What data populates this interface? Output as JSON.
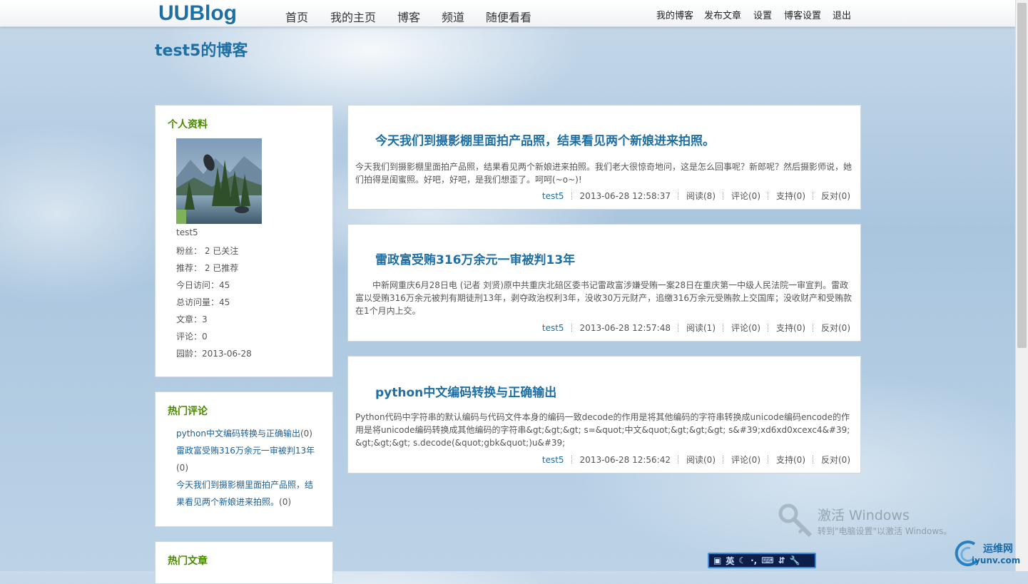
{
  "header": {
    "logo": "UUBlog",
    "main_nav": [
      "首页",
      "我的主页",
      "博客",
      "频道",
      "随便看看"
    ],
    "user_nav": [
      "我的博客",
      "发布文章",
      "设置",
      "博客设置",
      "退出"
    ]
  },
  "blog_title": "test5的博客",
  "profile": {
    "heading": "个人资料",
    "username": "test5",
    "stats": [
      "粉丝： 2 已关注",
      "推荐： 2 已推荐",
      "今日访问：45",
      "总访问量：45",
      "文章：3",
      "评论：0",
      "园龄：2013-06-28"
    ]
  },
  "hot_comments": {
    "heading": "热门评论",
    "items": [
      {
        "title": "python中文编码转换与正确输出",
        "count": "(0)"
      },
      {
        "title": "雷政富受贿316万余元一审被判13年",
        "count": "(0)"
      },
      {
        "title": "今天我们到摄影棚里面拍产品照，结果看见两个新娘进来拍照。",
        "count": "(0)"
      }
    ]
  },
  "hot_articles": {
    "heading": "热门文章"
  },
  "posts": [
    {
      "title": "今天我们到摄影棚里面拍产品照，结果看见两个新娘进来拍照。",
      "body": "今天我们到摄影棚里面拍产品照，结果看见两个新娘进来拍照。我们老大很惊奇地问，这是怎么回事呢？新郎呢？然后摄影师说，她们拍得是闺蜜照。好吧，好吧，是我们想歪了。呵呵(~o~)!",
      "author": "test5",
      "time": "2013-06-28 12:58:37",
      "reads": "阅读(8)",
      "comments": "评论(0)",
      "support": "支持(0)",
      "oppose": "反对(0)"
    },
    {
      "title": "雷政富受贿316万余元一审被判13年",
      "body": "　　中新网重庆6月28日电 (记者 刘贤)原中共重庆北碚区委书记雷政富涉嫌受贿一案28日在重庆第一中级人民法院一审宣判。雷政富以受贿316万余元被判有期徒刑13年，剥夺政治权利3年，没收30万元财产，追缴316万余元受贿款上交国库；没收财产和受贿款在1个月内上交。",
      "author": "test5",
      "time": "2013-06-28 12:57:48",
      "reads": "阅读(1)",
      "comments": "评论(0)",
      "support": "支持(0)",
      "oppose": "反对(0)"
    },
    {
      "title": "python中文编码转换与正确输出",
      "body": "Python代码中字符串的默认编码与代码文件本身的编码一致decode的作用是将其他编码的字符串转换成unicode编码encode的作用是将unicode编码转换成其他编码的字符串&gt;&gt;&gt; s=&quot;中文&quot;&gt;&gt;&gt; s&#39;xd6xd0xcexc4&#39;&gt;&gt;&gt; s.decode(&quot;gbk&quot;)u&#39;",
      "author": "test5",
      "time": "2013-06-28 12:56:42",
      "reads": "阅读(0)",
      "comments": "评论(0)",
      "support": "支持(0)",
      "oppose": "反对(0)"
    }
  ],
  "watermark": {
    "line1": "激活 Windows",
    "line2": "转到\"电脑设置\"以激活 Windows。"
  },
  "ime": {
    "lang": "英"
  },
  "brand": {
    "name": "运维网",
    "domain": "iyunv.com"
  }
}
